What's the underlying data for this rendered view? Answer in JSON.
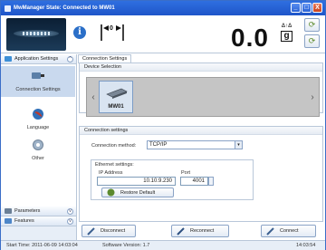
{
  "window": {
    "title": "MwManager  State: Connected to MW01",
    "buttons": [
      "_",
      "□",
      "X"
    ]
  },
  "header": {
    "weight_value": "0.0",
    "weight_mini": "Δ↑Δ",
    "weight_unit": "g",
    "zero_icon": "zero-arrows-icon",
    "info_icon": "info-icon"
  },
  "sidebar": {
    "group_application": "Application Settings",
    "items": [
      {
        "label": "Connection Settings",
        "icon": "plug-icon",
        "active": true
      },
      {
        "label": "Language",
        "icon": "globe-icon",
        "active": false
      },
      {
        "label": "Other",
        "icon": "gear-icon",
        "active": false
      }
    ],
    "group_parameters": "Parameters",
    "group_features": "Features"
  },
  "main": {
    "tab_label": "Connection Settings",
    "device_selection": {
      "heading": "Device Selection",
      "devices": [
        {
          "name": "MW01"
        }
      ]
    },
    "connection": {
      "heading": "Connection settings",
      "method_label": "Connection method:",
      "method_value": "TCP/IP",
      "ethernet_label": "Ethernet settings:",
      "ip_label": "IP Address",
      "ip_value": "10.10.9.230",
      "port_label": "Port",
      "port_value": "4001",
      "restore_label": "Restore Default"
    },
    "actions": {
      "disconnect": "Disconnect",
      "reconnect": "Reconnect",
      "connect": "Connect"
    }
  },
  "statusbar": {
    "start_time": "Start Time: 2011-06-09 14:03:04",
    "software_version": "Software Version: 1.7",
    "clock": "14:03:54"
  },
  "colors": {
    "titlebar": "#1f55c9",
    "accent": "#2b6fc8",
    "active_item": "#c9d9ee"
  }
}
